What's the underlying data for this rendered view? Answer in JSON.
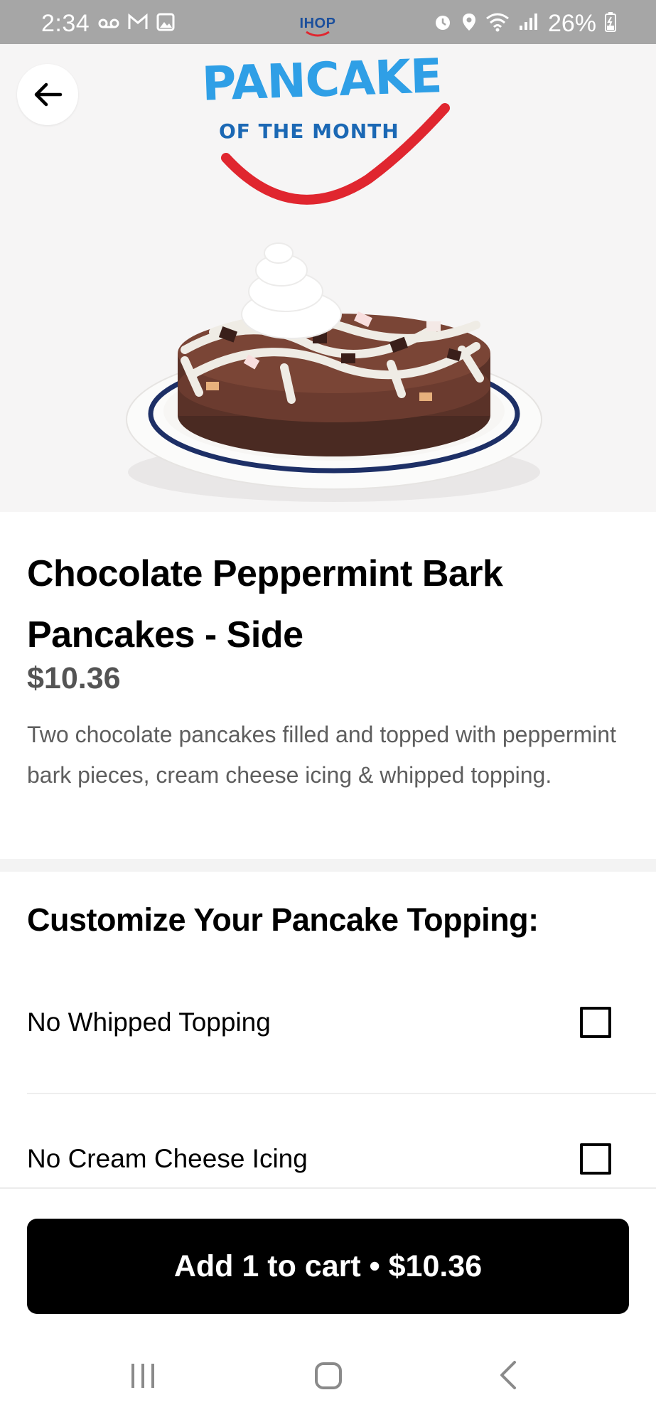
{
  "status_bar": {
    "time": "2:34",
    "left_icons": [
      "voicemail-icon",
      "gmail-icon",
      "gallery-icon"
    ],
    "center_app": "IHOP",
    "right_icons": [
      "alarm-icon",
      "location-icon",
      "wifi-icon",
      "signal-icon"
    ],
    "battery": "26%"
  },
  "hero": {
    "promo_title": "PANCAKE",
    "promo_subtitle": "OF THE MONTH"
  },
  "item": {
    "title": "Chocolate Peppermint Bark Pancakes - Side",
    "price": "$10.36",
    "description": "Two chocolate pancakes filled and topped with peppermint bark pieces, cream cheese icing & whipped topping."
  },
  "customize": {
    "heading": "Customize Your Pancake Topping:",
    "options": [
      {
        "label": "No Whipped Topping",
        "checked": false
      },
      {
        "label": "No Cream Cheese Icing",
        "checked": false
      }
    ]
  },
  "cart": {
    "button_label": "Add 1 to cart • $10.36"
  },
  "colors": {
    "status_bar": "#a6a6a6",
    "promo_blue": "#2f9fe6",
    "promo_red": "#e0262f",
    "button": "#000000"
  }
}
